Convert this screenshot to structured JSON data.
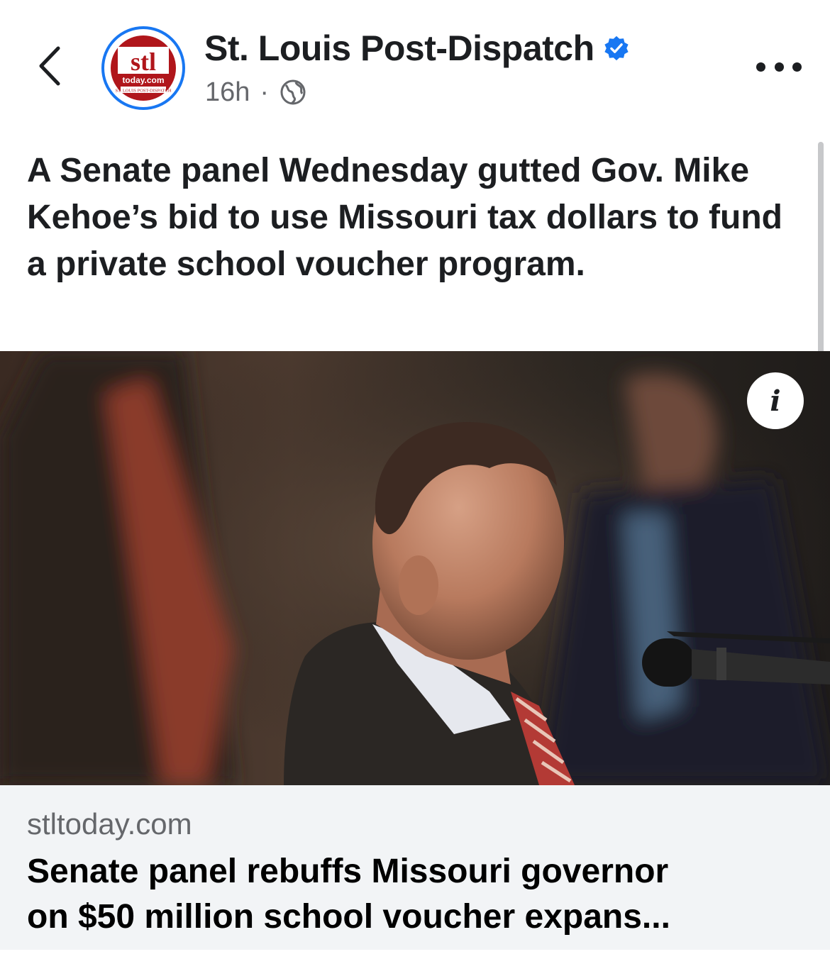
{
  "post": {
    "page_name": "St. Louis Post-Dispatch",
    "time": "16h",
    "separator": "·",
    "audience_icon": "globe-icon",
    "verified_icon": "verified-badge-icon",
    "text": "A Senate panel Wednesday gutted Gov. Mike Kehoe’s bid to use Missouri tax dollars to fund a private school voucher program."
  },
  "avatar": {
    "logo_text": "stl",
    "logo_sub": "today.com",
    "logo_band": "ST. LOUIS POST-DISPATCH"
  },
  "link": {
    "domain": "stltoday.com",
    "title": "Senate panel rebuffs Missouri governor\non $50 million school voucher expans..."
  },
  "info_icon": "i",
  "colors": {
    "accent": "#1877f2",
    "logo_red": "#b0161b",
    "card_bg": "#f2f4f6",
    "meta_text": "#65676b"
  }
}
